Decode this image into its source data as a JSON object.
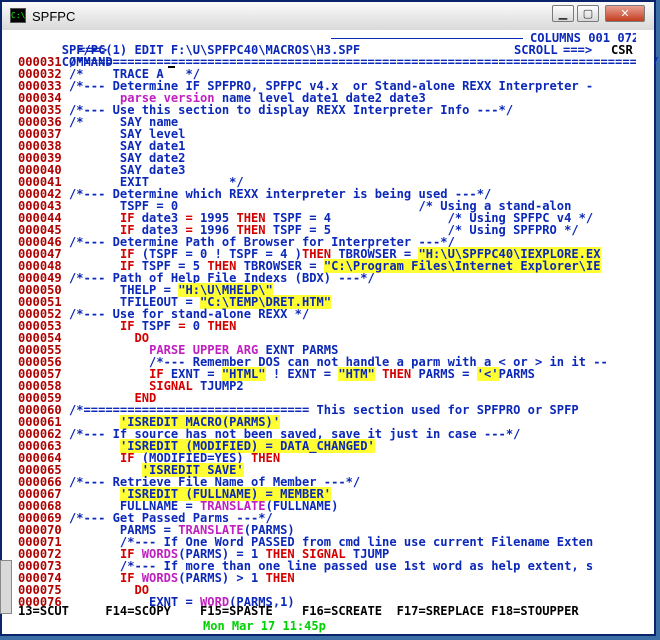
{
  "window": {
    "title": "SPFPC",
    "icon_name": "terminal-icon",
    "minimize_symbol": "▁",
    "maximize_symbol": "▢",
    "close_symbol": "✕"
  },
  "header": {
    "path_text": "SPF/PC(1) EDIT F:\\U\\SPFPC40\\MACROS\\H3.SPF",
    "columns_text": "COLUMNS 001 072",
    "command_label": "COMMAND",
    "command_arrow": "===>",
    "command_value": "",
    "scroll_label": "SCROLL",
    "scroll_arrow": "===>",
    "scroll_value": "CSR"
  },
  "lines": [
    [
      "000031",
      [
        [
          "blue",
          "/*=============================================================================*/"
        ]
      ]
    ],
    [
      "000032",
      [
        [
          "blue",
          "/*    TRACE A   */"
        ]
      ]
    ],
    [
      "000033",
      [
        [
          "blue",
          "/*--- Determine IF SPFPRO, SPFPC v4.x  or Stand-alone REXX Interpreter -"
        ]
      ]
    ],
    [
      "000034",
      [
        [
          "blue",
          "       "
        ],
        [
          "mag",
          "parse version"
        ],
        [
          "blue",
          " name level date1 date2 date3"
        ]
      ]
    ],
    [
      "000035",
      [
        [
          "blue",
          "/*--- Use this section to display REXX Interpreter Info ---*/"
        ]
      ]
    ],
    [
      "000036",
      [
        [
          "blue",
          "/*     SAY name"
        ]
      ]
    ],
    [
      "000037",
      [
        [
          "blue",
          "       SAY level"
        ]
      ]
    ],
    [
      "000038",
      [
        [
          "blue",
          "       SAY date1"
        ]
      ]
    ],
    [
      "000039",
      [
        [
          "blue",
          "       SAY date2"
        ]
      ]
    ],
    [
      "000040",
      [
        [
          "blue",
          "       SAY date3"
        ]
      ]
    ],
    [
      "000041",
      [
        [
          "blue",
          "       EXIT           */"
        ]
      ]
    ],
    [
      "000042",
      [
        [
          "blue",
          "/*--- Determine which REXX interpreter is being used ---*/"
        ]
      ]
    ],
    [
      "000043",
      [
        [
          "blue",
          "       TSPF = 0                                 /* Using a stand-alon"
        ]
      ]
    ],
    [
      "000044",
      [
        [
          "blue",
          "       "
        ],
        [
          "red",
          "IF"
        ],
        [
          "blue",
          " date3 "
        ],
        [
          "red",
          "="
        ],
        [
          "blue",
          " 1995 "
        ],
        [
          "red",
          "THEN"
        ],
        [
          "blue",
          " TSPF = 4                /* Using SPFPC v4 */"
        ]
      ]
    ],
    [
      "000045",
      [
        [
          "blue",
          "       "
        ],
        [
          "red",
          "IF"
        ],
        [
          "blue",
          " date3 "
        ],
        [
          "red",
          "="
        ],
        [
          "blue",
          " 1996 "
        ],
        [
          "red",
          "THEN"
        ],
        [
          "blue",
          " TSPF = 5                /* Using SPFPRO */"
        ]
      ]
    ],
    [
      "000046",
      [
        [
          "blue",
          "/*--- Determine Path of Browser for Interpreter ---*/"
        ]
      ]
    ],
    [
      "000047",
      [
        [
          "blue",
          "       "
        ],
        [
          "red",
          "IF"
        ],
        [
          "blue",
          " (TSPF = 0 ! TSPF = 4 )"
        ],
        [
          "red",
          "THEN"
        ],
        [
          "blue",
          " TBROWSER = "
        ],
        [
          "hl",
          "\"H:\\U\\SPFPC40\\IEXPLORE.EX"
        ]
      ]
    ],
    [
      "000048",
      [
        [
          "blue",
          "       "
        ],
        [
          "red",
          "IF"
        ],
        [
          "blue",
          " TSPF = 5 "
        ],
        [
          "red",
          "THEN"
        ],
        [
          "blue",
          " TBROWSER = "
        ],
        [
          "hl",
          "\"C:\\Program Files\\Internet Explorer\\IE"
        ]
      ]
    ],
    [
      "000049",
      [
        [
          "blue",
          "/*--- Path of Help File Indexs (BDX) ---*/"
        ]
      ]
    ],
    [
      "000050",
      [
        [
          "blue",
          "       THELP = "
        ],
        [
          "hl",
          "\"H:\\U\\MHELP\\\""
        ]
      ]
    ],
    [
      "000051",
      [
        [
          "blue",
          "       TFILEOUT = "
        ],
        [
          "hl",
          "\"C:\\TEMP\\DRET.HTM\""
        ]
      ]
    ],
    [
      "000052",
      [
        [
          "blue",
          "/*--- Use for stand-alone REXX */"
        ]
      ]
    ],
    [
      "000053",
      [
        [
          "blue",
          "       "
        ],
        [
          "red",
          "IF"
        ],
        [
          "blue",
          " TSPF "
        ],
        [
          "red",
          "="
        ],
        [
          "blue",
          " 0 "
        ],
        [
          "red",
          "THEN"
        ]
      ]
    ],
    [
      "000054",
      [
        [
          "blue",
          "         "
        ],
        [
          "red",
          "DO"
        ]
      ]
    ],
    [
      "000055",
      [
        [
          "blue",
          "           "
        ],
        [
          "mag",
          "PARSE UPPER ARG"
        ],
        [
          "blue",
          " EXNT PARMS"
        ]
      ]
    ],
    [
      "000056",
      [
        [
          "blue",
          "           /*--- Remember DOS can not handle a parm with a < or > in it --"
        ]
      ]
    ],
    [
      "000057",
      [
        [
          "blue",
          "           "
        ],
        [
          "red",
          "IF"
        ],
        [
          "blue",
          " EXNT = "
        ],
        [
          "hl",
          "\"HTML\""
        ],
        [
          "blue",
          " ! EXNT = "
        ],
        [
          "hl",
          "\"HTM\""
        ],
        [
          "blue",
          " "
        ],
        [
          "red",
          "THEN"
        ],
        [
          "blue",
          " PARMS = "
        ],
        [
          "hl",
          "'<'"
        ],
        [
          "blue",
          "PARMS"
        ]
      ]
    ],
    [
      "000058",
      [
        [
          "blue",
          "           "
        ],
        [
          "red",
          "SIGNAL"
        ],
        [
          "blue",
          " TJUMP2"
        ]
      ]
    ],
    [
      "000059",
      [
        [
          "blue",
          "         "
        ],
        [
          "red",
          "END"
        ]
      ]
    ],
    [
      "000060",
      [
        [
          "blue",
          "/*=============================== This section used for SPFPRO or SPFP"
        ]
      ]
    ],
    [
      "000061",
      [
        [
          "blue",
          "       "
        ],
        [
          "hl",
          "'ISREDIT MACRO(PARMS)'"
        ]
      ]
    ],
    [
      "000062",
      [
        [
          "blue",
          "/*--- If source has not been saved, save it just in case ---*/"
        ]
      ]
    ],
    [
      "000063",
      [
        [
          "blue",
          "       "
        ],
        [
          "hl",
          "'ISREDIT (MODIFIED) = DATA_CHANGED'"
        ]
      ]
    ],
    [
      "000064",
      [
        [
          "blue",
          "       "
        ],
        [
          "red",
          "IF"
        ],
        [
          "blue",
          " (MODIFIED=YES) "
        ],
        [
          "red",
          "THEN"
        ]
      ]
    ],
    [
      "000065",
      [
        [
          "blue",
          "          "
        ],
        [
          "hl",
          "'ISREDIT SAVE'"
        ]
      ]
    ],
    [
      "000066",
      [
        [
          "blue",
          "/*--- Retrieve File Name of Member ---*/"
        ]
      ]
    ],
    [
      "000067",
      [
        [
          "blue",
          "       "
        ],
        [
          "hl",
          "'ISREDIT (FULLNAME) = MEMBER'"
        ]
      ]
    ],
    [
      "000068",
      [
        [
          "blue",
          "       FULLNAME = "
        ],
        [
          "mag",
          "TRANSLATE"
        ],
        [
          "blue",
          "(FULLNAME)"
        ]
      ]
    ],
    [
      "000069",
      [
        [
          "blue",
          "/*--- Get Passed Parms ---*/"
        ]
      ]
    ],
    [
      "000070",
      [
        [
          "blue",
          "       PARMS = "
        ],
        [
          "mag",
          "TRANSLATE"
        ],
        [
          "blue",
          "(PARMS)"
        ]
      ]
    ],
    [
      "000071",
      [
        [
          "blue",
          "       /*--- If One Word PASSED from cmd line use current Filename Exten"
        ]
      ]
    ],
    [
      "000072",
      [
        [
          "blue",
          "       "
        ],
        [
          "red",
          "IF"
        ],
        [
          "blue",
          " "
        ],
        [
          "mag",
          "WORDS"
        ],
        [
          "blue",
          "(PARMS) = 1 "
        ],
        [
          "red",
          "THEN"
        ],
        [
          "blue",
          " "
        ],
        [
          "red",
          "SIGNAL"
        ],
        [
          "blue",
          " TJUMP"
        ]
      ]
    ],
    [
      "000073",
      [
        [
          "blue",
          "       /*--- If more than one line passed use 1st word as help extent, s"
        ]
      ]
    ],
    [
      "000074",
      [
        [
          "blue",
          "       "
        ],
        [
          "red",
          "IF"
        ],
        [
          "blue",
          " "
        ],
        [
          "mag",
          "WORDS"
        ],
        [
          "blue",
          "(PARMS) > 1 "
        ],
        [
          "red",
          "THEN"
        ]
      ]
    ],
    [
      "000075",
      [
        [
          "blue",
          "         "
        ],
        [
          "red",
          "DO"
        ]
      ]
    ],
    [
      "000076",
      [
        [
          "blue",
          "           EXNT = "
        ],
        [
          "mag",
          "WORD"
        ],
        [
          "blue",
          "(PARMS,1)"
        ]
      ]
    ]
  ],
  "function_keys": "13=SCUT     F14=SCOPY    F15=SPASTE    F16=SCREATE  F17=SREPLACE F18=STOUPPER",
  "status_bar": "Mon Mar 17 11:45p",
  "colors": {
    "blue": "#0b28b8",
    "red": "#d40000",
    "magenta": "#c020c0",
    "highlight": "#ffff33",
    "status": "#00d000",
    "line_numbers": "#b00000"
  }
}
